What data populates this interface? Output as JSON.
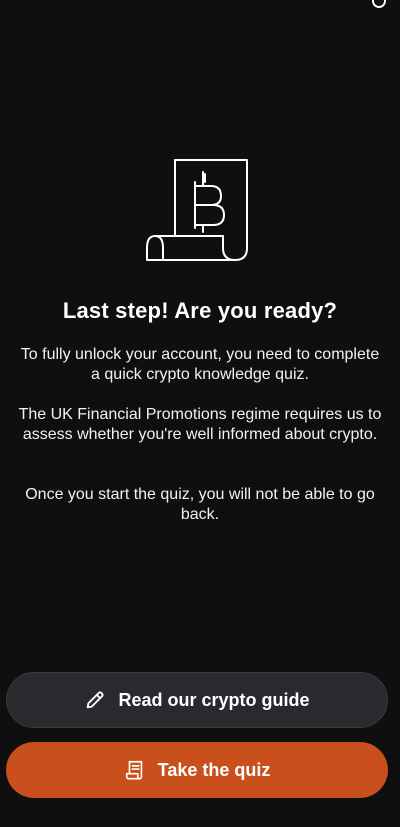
{
  "screen": {
    "title": "Last step! Are you ready?",
    "paragraph_1": "To fully unlock your account, you need to complete a quick crypto knowledge quiz.",
    "paragraph_2": "The UK Financial Promotions regime requires us to assess whether you're well informed about crypto.",
    "paragraph_3": "Once you start the quiz, you will not be able to go back."
  },
  "illustration": {
    "icon": "bitcoin-document-icon"
  },
  "buttons": {
    "guide_label": "Read our crypto guide",
    "guide_icon": "pencil-icon",
    "quiz_label": "Take the quiz",
    "quiz_icon": "document-icon"
  },
  "colors": {
    "background": "#0f0f0f",
    "secondary_button": "#2a2a2e",
    "primary_button": "#c9501c",
    "text": "#ffffff"
  }
}
